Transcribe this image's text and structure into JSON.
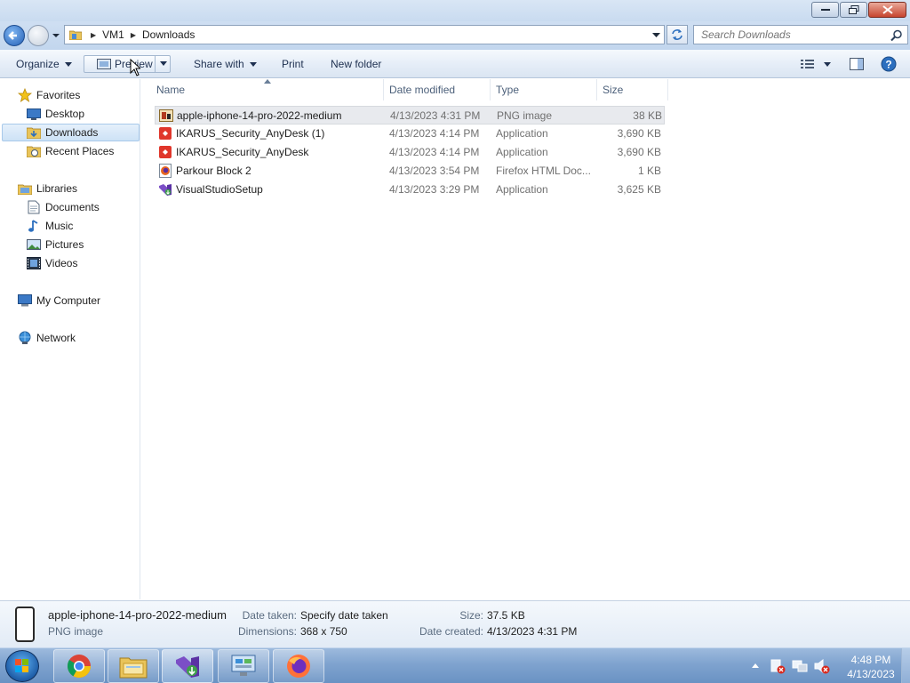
{
  "window": {
    "title": "Downloads"
  },
  "address": {
    "crumbs": [
      "VM1",
      "Downloads"
    ]
  },
  "search": {
    "placeholder": "Search Downloads"
  },
  "toolbar": {
    "organize": "Organize",
    "preview": "Preview",
    "share": "Share with",
    "print": "Print",
    "new_folder": "New folder"
  },
  "nav": {
    "favorites": "Favorites",
    "desktop": "Desktop",
    "downloads": "Downloads",
    "recent": "Recent Places",
    "libraries": "Libraries",
    "documents": "Documents",
    "music": "Music",
    "pictures": "Pictures",
    "videos": "Videos",
    "computer": "My Computer",
    "network": "Network"
  },
  "columns": {
    "name": "Name",
    "date": "Date modified",
    "type": "Type",
    "size": "Size"
  },
  "files": [
    {
      "name": "apple-iphone-14-pro-2022-medium",
      "date": "4/13/2023 4:31 PM",
      "type": "PNG image",
      "size": "38 KB",
      "icon": "png-image-icon"
    },
    {
      "name": "IKARUS_Security_AnyDesk (1)",
      "date": "4/13/2023 4:14 PM",
      "type": "Application",
      "size": "3,690 KB",
      "icon": "anydesk-icon"
    },
    {
      "name": "IKARUS_Security_AnyDesk",
      "date": "4/13/2023 4:14 PM",
      "type": "Application",
      "size": "3,690 KB",
      "icon": "anydesk-icon"
    },
    {
      "name": "Parkour Block 2",
      "date": "4/13/2023 3:54 PM",
      "type": "Firefox HTML Doc...",
      "size": "1 KB",
      "icon": "firefox-html-icon"
    },
    {
      "name": "VisualStudioSetup",
      "date": "4/13/2023 3:29 PM",
      "type": "Application",
      "size": "3,625 KB",
      "icon": "visual-studio-icon"
    }
  ],
  "details": {
    "name": "apple-iphone-14-pro-2022-medium",
    "type": "PNG image",
    "date_taken_label": "Date taken:",
    "date_taken": "Specify date taken",
    "dimensions_label": "Dimensions:",
    "dimensions": "368 x 750",
    "size_label": "Size:",
    "size": "37.5 KB",
    "created_label": "Date created:",
    "created": "4/13/2023 4:31 PM"
  },
  "taskbar": {
    "apps": [
      "chrome-icon",
      "explorer-icon",
      "visual-studio-installer-icon",
      "control-panel-icon",
      "firefox-icon"
    ],
    "time": "4:48 PM",
    "date": "4/13/2023"
  },
  "colors": {
    "accent": "#2560b6",
    "selection": "#cde2f6",
    "taskbar": "#7fa3cf"
  }
}
